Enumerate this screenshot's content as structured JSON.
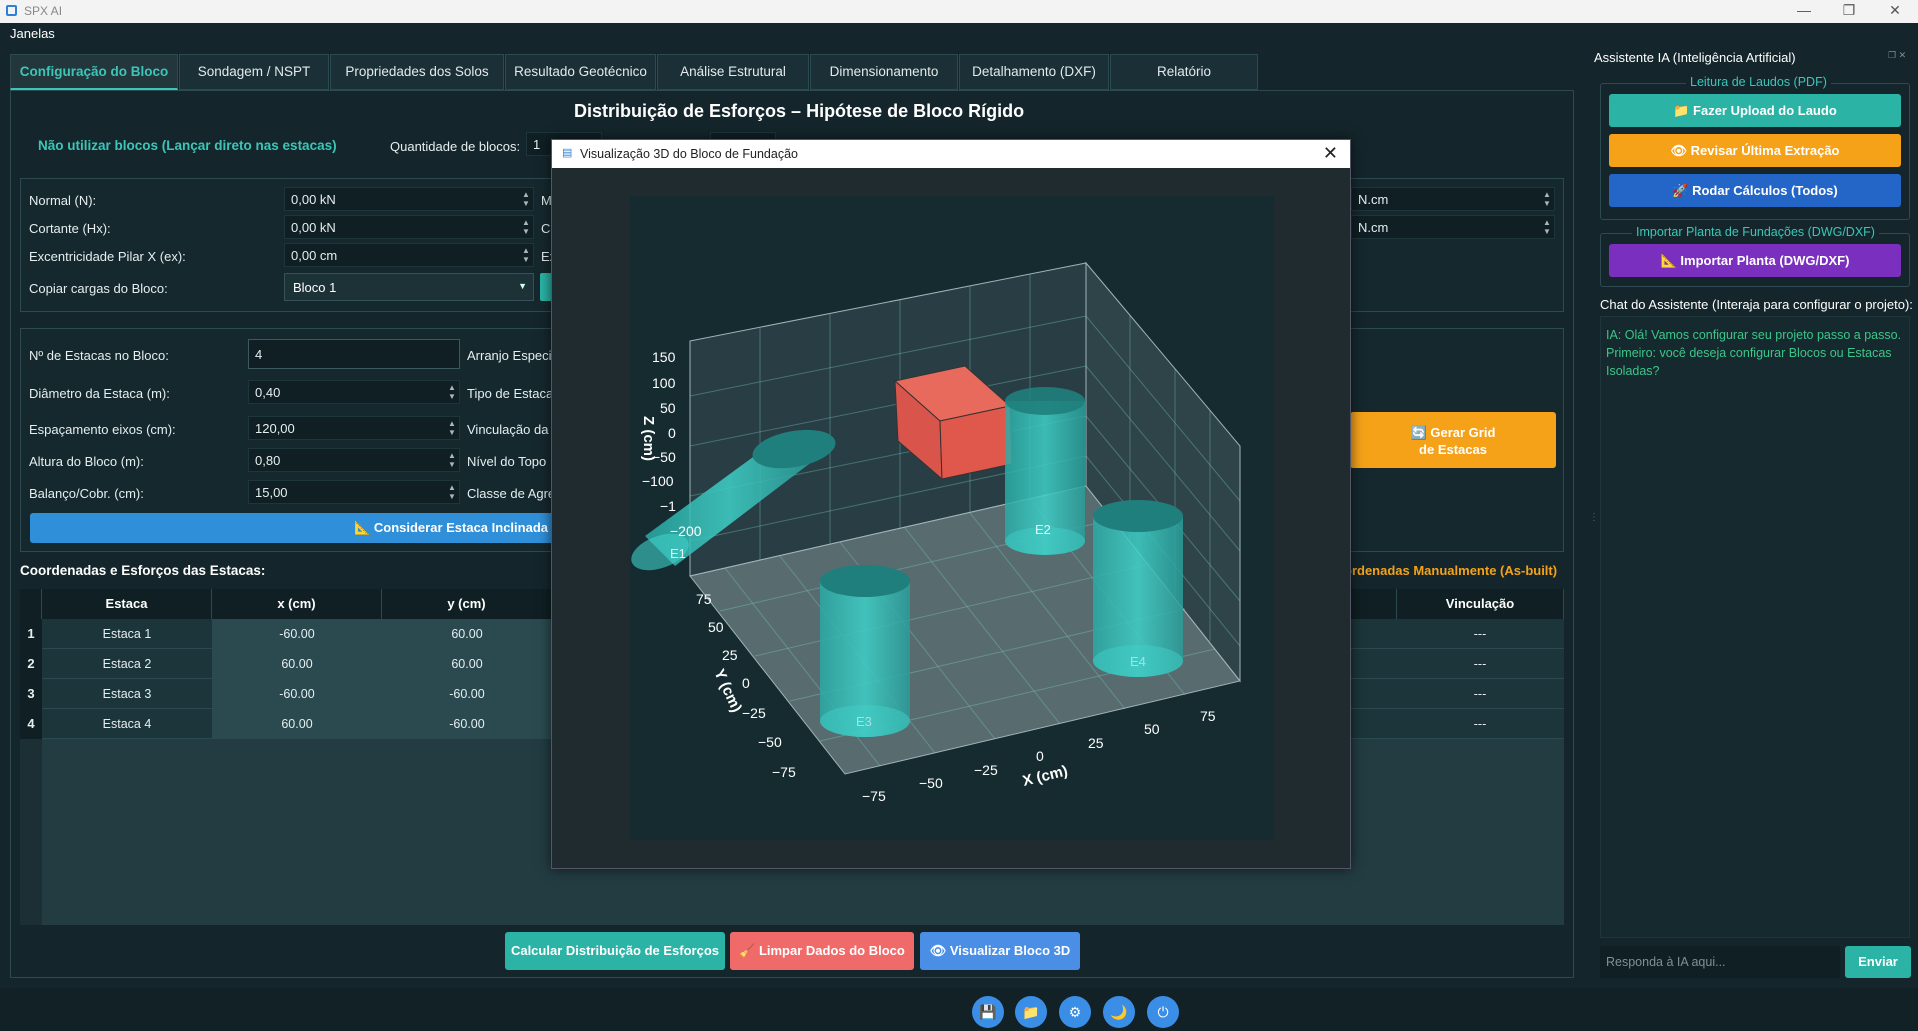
{
  "window": {
    "title": "SPX AI",
    "minimize": "—",
    "restore": "❐",
    "close": "✕"
  },
  "menu": {
    "janelas": "Janelas"
  },
  "tabs": [
    "Configuração do Bloco",
    "Sondagem / NSPT",
    "Propriedades dos Solos",
    "Resultado Geotécnico",
    "Análise Estrutural",
    "Dimensionamento",
    "Detalhamento (DXF)",
    "Relatório"
  ],
  "main": {
    "heading": "Distribuição de Esforços – Hipótese de Bloco Rígido",
    "no_blocks_checkbox": "Não utilizar blocos (Lançar direto nas estacas)",
    "qty_blocks_label": "Quantidade de blocos:",
    "qty_blocks_value": "1",
    "loads": {
      "normal_label": "Normal (N):",
      "normal_value": "0,00 kN",
      "shear_label": "Cortante (Hx):",
      "shear_value": "0,00 kN",
      "ecc_label": "Excentricidade Pilar X (ex):",
      "ecc_value": "0,00 cm",
      "copy_label": "Copiar cargas do Bloco:",
      "copy_value": "Bloco 1",
      "m_label_1": "M",
      "c_label_2": "C",
      "e_label_3": "Ex",
      "right_unit_1": "N.cm",
      "right_unit_2": "N.cm"
    },
    "piles": {
      "n_label": "Nº de Estacas no Bloco:",
      "n_value": "4",
      "diam_label": "Diâmetro da Estaca (m):",
      "diam_value": "0,40",
      "spacing_label": "Espaçamento eixos (cm):",
      "spacing_value": "120,00",
      "height_label": "Altura do Bloco (m):",
      "height_value": "0,80",
      "cover_label": "Balanço/Cobr. (cm):",
      "cover_value": "15,00",
      "arranjo_label": "Arranjo Especi",
      "tipo_label": "Tipo de Estaca",
      "vinc_label": "Vinculação da",
      "nivel_label": "Nível do Topo",
      "classe_label": "Classe de Agre",
      "inclined_button": "📐 Considerar Estaca Inclinada",
      "grid_button_line1": "🔄 Gerar Grid",
      "grid_button_line2": "de Estacas"
    },
    "coords_title": "Coordenadas e Esforços das Estacas:",
    "asbuilt_label": "ordenadas Manualmente (As-built)",
    "table": {
      "headers": [
        "Estaca",
        "x (cm)",
        "y (cm)",
        "Vinculação"
      ],
      "rows": [
        {
          "num": "1",
          "estaca": "Estaca 1",
          "x": "-60.00",
          "y": "60.00",
          "vinc": "---"
        },
        {
          "num": "2",
          "estaca": "Estaca 2",
          "x": "60.00",
          "y": "60.00",
          "vinc": "---"
        },
        {
          "num": "3",
          "estaca": "Estaca 3",
          "x": "-60.00",
          "y": "-60.00",
          "vinc": "---"
        },
        {
          "num": "4",
          "estaca": "Estaca 4",
          "x": "60.00",
          "y": "-60.00",
          "vinc": "---"
        }
      ]
    },
    "buttons": {
      "calc": "Calcular Distribuição de Esforços",
      "clear": "🧹 Limpar Dados do Bloco",
      "view3d": "👁 Visualizar Bloco 3D"
    }
  },
  "sidebar": {
    "title": "Assistente IA (Inteligência Artificial)",
    "laudos_group": "Leitura de Laudos (PDF)",
    "upload_button": "📁 Fazer Upload do Laudo",
    "review_button": "👁 Revisar Última Extração",
    "run_button": "🚀 Rodar Cálculos (Todos)",
    "planta_group": "Importar Planta de Fundações (DWG/DXF)",
    "import_button": "📐 Importar Planta (DWG/DXF)",
    "chat_label": "Chat do Assistente (Interaja para configurar o projeto):",
    "chat_message": "IA: Olá! Vamos configurar seu projeto passo a passo. Primeiro: você deseja configurar Blocos ou Estacas Isoladas?",
    "chat_placeholder": "Responda à IA aqui...",
    "send_button": "Enviar"
  },
  "footer_icons": [
    "💾",
    "📁",
    "⚙",
    "🌙",
    "⏻"
  ],
  "dialog": {
    "title": "Visualização 3D do Bloco de Fundação",
    "close": "✕",
    "plot": {
      "z_label": "Z (cm)",
      "y_label": "Y (cm)",
      "x_label": "X (cm)",
      "z_ticks": [
        "150",
        "100",
        "50",
        "0",
        "−50",
        "−100",
        "−1",
        "−200"
      ],
      "y_ticks": [
        "75",
        "50",
        "25",
        "0",
        "−25",
        "−50",
        "−75"
      ],
      "x_ticks": [
        "−75",
        "−50",
        "−25",
        "0",
        "25",
        "50",
        "75"
      ],
      "pile_labels": [
        "E1",
        "E2",
        "E3",
        "E4"
      ]
    }
  },
  "colors": {
    "accent": "#3cc6b8",
    "orange": "#f5a219",
    "blue": "#2f8fd8",
    "red": "#f06a6a",
    "purple": "#7b2fbf",
    "block": "#e0584b",
    "pile": "#36c4bd"
  }
}
